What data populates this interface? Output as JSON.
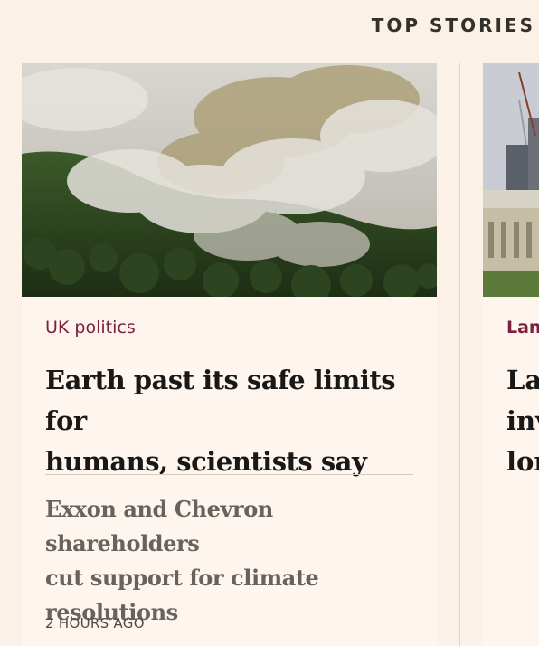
{
  "section": {
    "title": "TOP STORIES"
  },
  "stories": [
    {
      "topic": "UK politics",
      "headline_line1": "Earth past its safe limits for",
      "headline_line2": "humans, scientists say",
      "related_line1": "Exxon and Chevron shareholders",
      "related_line2": "cut support for climate",
      "related_line3": "resolutions",
      "timestamp": "2 HOURS AGO",
      "image_subject": "forest fire smoke over rainforest"
    },
    {
      "topic_partial": "Lan",
      "headline_partial_line1": "La",
      "headline_partial_line2": "inv",
      "headline_partial_line3": "lon",
      "image_subject": "city skyline with construction cranes"
    }
  ],
  "colors": {
    "background": "#fcf1e6",
    "card": "#fdf5ee",
    "topic": "#7d1f3e",
    "headline": "#1a1817",
    "related": "#67625e"
  }
}
